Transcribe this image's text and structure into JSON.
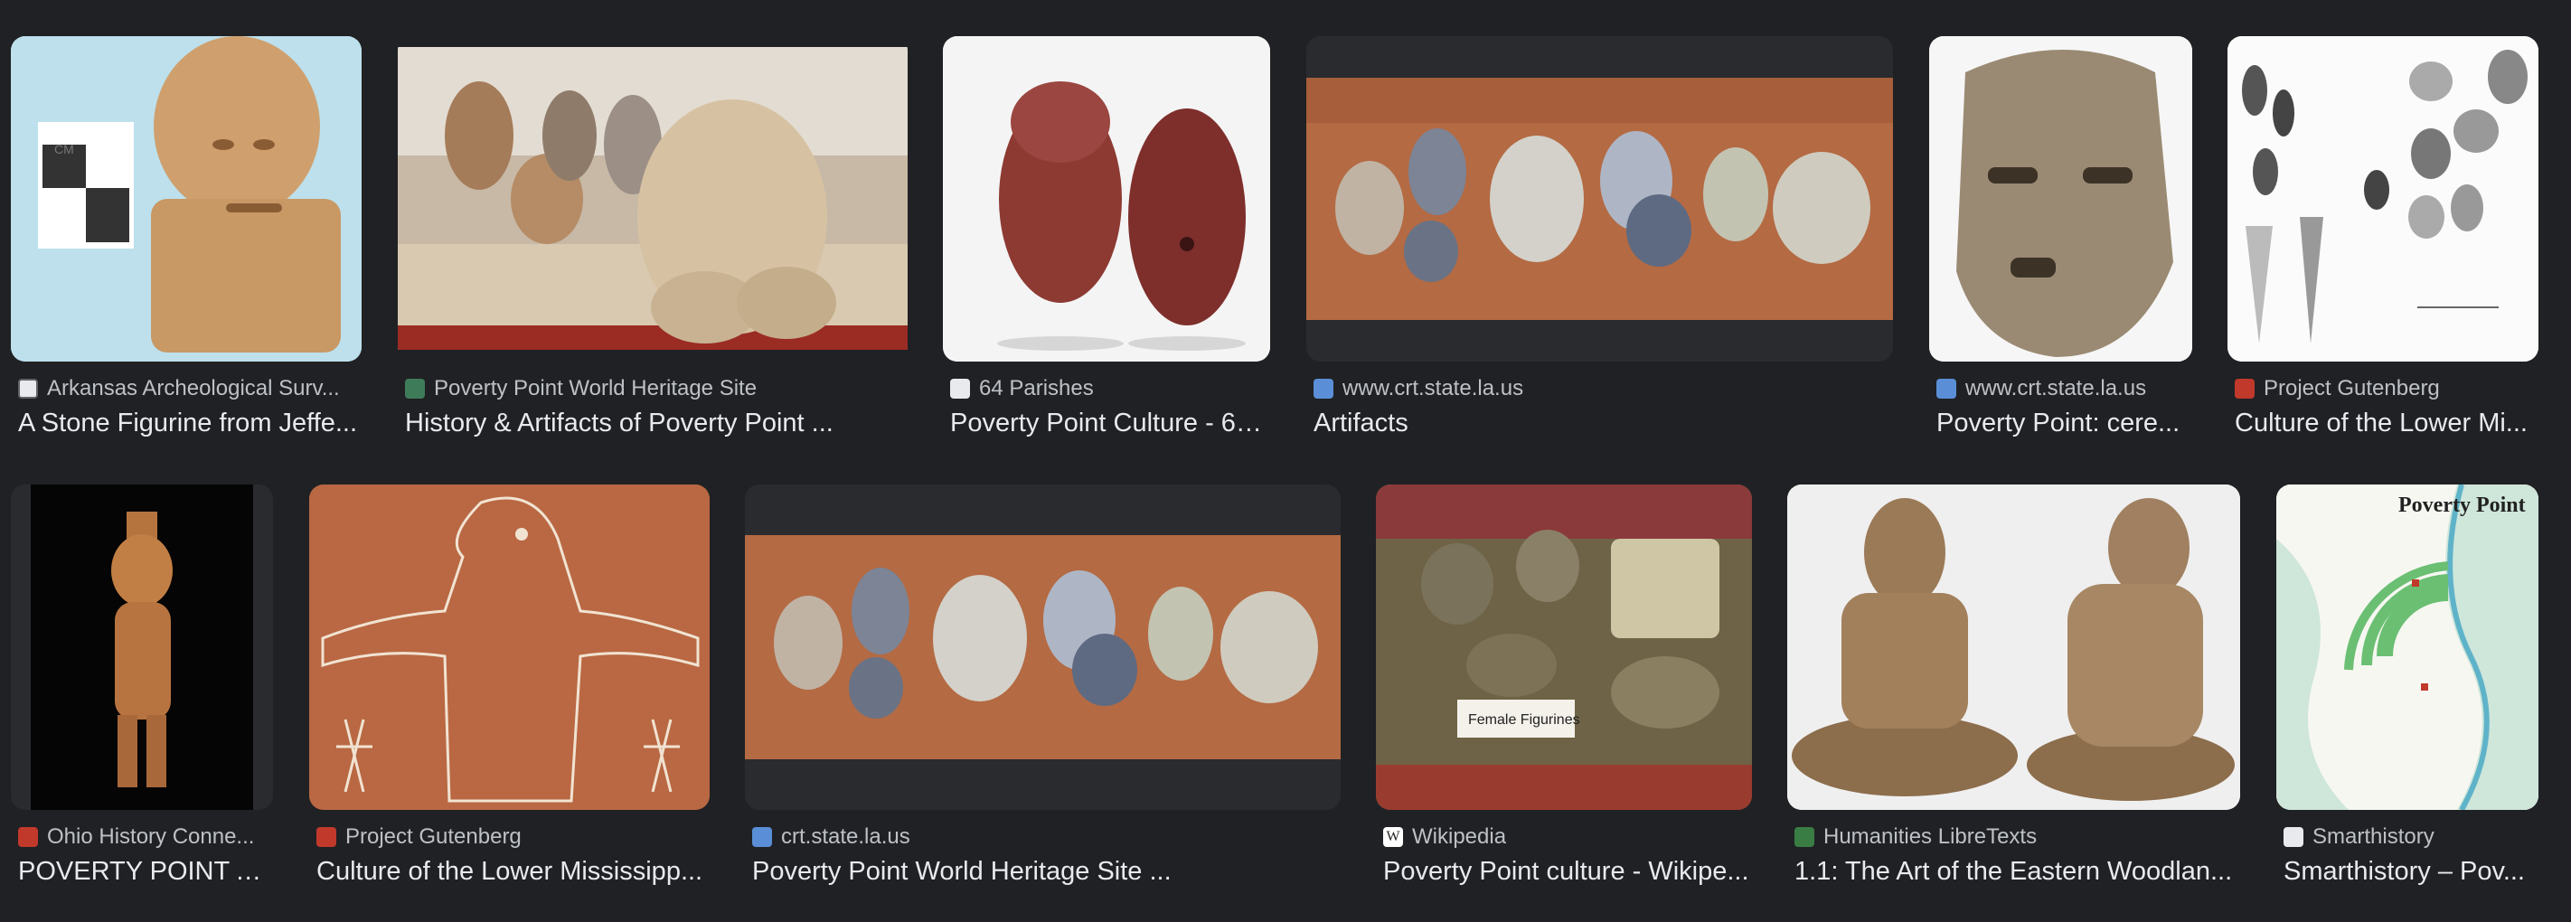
{
  "results": [
    {
      "source": "Arkansas Archeological Surv...",
      "title": "A Stone Figurine from Jeffe...",
      "favicon": "arkansas-archeological-icon"
    },
    {
      "source": "Poverty Point World Heritage Site",
      "title": "History & Artifacts of Poverty Point ...",
      "favicon": "poverty-point-site-icon"
    },
    {
      "source": "64 Parishes",
      "title": "Poverty Point Culture - 64...",
      "favicon": "64-parishes-icon"
    },
    {
      "source": "www.crt.state.la.us",
      "title": "Artifacts",
      "favicon": "crt-state-icon"
    },
    {
      "source": "www.crt.state.la.us",
      "title": "Poverty Point: cere...",
      "favicon": "crt-state-icon"
    },
    {
      "source": "Project Gutenberg",
      "title": "Culture of the Lower Mi...",
      "favicon": "project-gutenberg-icon"
    },
    {
      "source": "Ohio History Conne...",
      "title": "POVERTY POINT A...",
      "favicon": "ohio-history-icon"
    },
    {
      "source": "Project Gutenberg",
      "title": "Culture of the Lower Mississipp...",
      "favicon": "project-gutenberg-icon"
    },
    {
      "source": "crt.state.la.us",
      "title": "Poverty Point World Heritage Site ...",
      "favicon": "crt-state-icon"
    },
    {
      "source": "Wikipedia",
      "title": "Poverty Point culture - Wikipe...",
      "favicon": "wikipedia-icon"
    },
    {
      "source": "Humanities LibreTexts",
      "title": "1.1: The Art of the Eastern Woodlan...",
      "favicon": "libretexts-icon"
    },
    {
      "source": "Smarthistory",
      "title": "Smarthistory – Pov...",
      "favicon": "smarthistory-icon"
    }
  ],
  "image_text": {
    "scale_label": "CM",
    "placard": "Female Figurines",
    "map_title": "Poverty Point"
  }
}
